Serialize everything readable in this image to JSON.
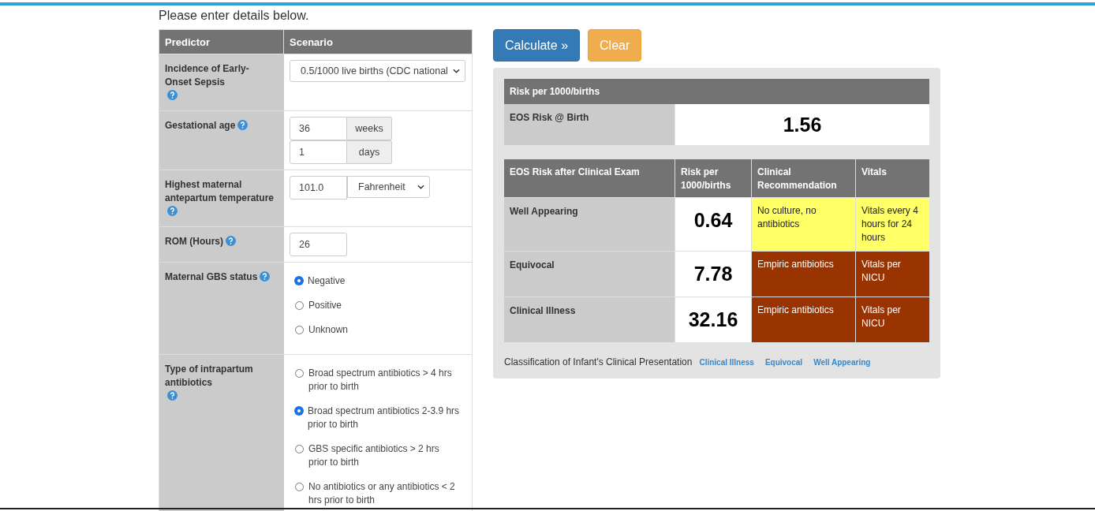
{
  "intro": "Please enter details below.",
  "predictors": {
    "columns": [
      "Predictor",
      "Scenario"
    ],
    "rows": [
      {
        "label": "Incidence of Early-Onset Sepsis",
        "kind": "select",
        "value": "0.5/1000 live births (CDC national"
      },
      {
        "label": "Gestational age",
        "kind": "units",
        "fields": [
          {
            "value": "36",
            "unit": "weeks"
          },
          {
            "value": "1",
            "unit": "days"
          }
        ]
      },
      {
        "label": "Highest maternal antepartum temperature",
        "kind": "input-select",
        "value": "101.0",
        "unit": "Fahrenheit"
      },
      {
        "label": "ROM (Hours)",
        "kind": "input",
        "value": "26"
      },
      {
        "label": "Maternal GBS status",
        "kind": "radio",
        "options": [
          {
            "label": "Negative",
            "selected": true
          },
          {
            "label": "Positive",
            "selected": false
          },
          {
            "label": "Unknown",
            "selected": false
          }
        ]
      },
      {
        "label": "Type of intrapartum antibiotics",
        "kind": "radio",
        "options": [
          {
            "label": "Broad spectrum antibiotics > 4 hrs prior to birth",
            "selected": false
          },
          {
            "label": "Broad spectrum antibiotics 2-3.9 hrs prior to birth",
            "selected": true
          },
          {
            "label": "GBS specific antibiotics > 2 hrs prior to birth",
            "selected": false
          },
          {
            "label": "No antibiotics or any antibiotics < 2 hrs prior to birth",
            "selected": false
          }
        ]
      }
    ]
  },
  "buttons": [
    {
      "label": "Calculate »",
      "kind": "primary"
    },
    {
      "label": "Clear",
      "kind": "warning"
    }
  ],
  "birth_risk": {
    "header": "Risk per 1000/births",
    "label": "EOS Risk @ Birth",
    "value": "1.56"
  },
  "exam_risk": {
    "columns": [
      "EOS Risk after Clinical Exam",
      "Risk per 1000/births",
      "Clinical Recommendation",
      "Vitals"
    ],
    "rows": [
      {
        "label": "Well Appearing",
        "risk": "0.64",
        "recommendation": "No culture, no antibiotics",
        "vitals": "Vitals every 4 hours for 24 hours",
        "color": "#ffff66"
      },
      {
        "label": "Equivocal",
        "risk": "7.78",
        "recommendation": "Empiric antibiotics",
        "vitals": "Vitals per NICU",
        "color": "#993300"
      },
      {
        "label": "Clinical Illness",
        "risk": "32.16",
        "recommendation": "Empiric antibiotics",
        "vitals": "Vitals per NICU",
        "color": "#993300"
      }
    ]
  },
  "classification": {
    "label": "Classification of Infant's Clinical Presentation",
    "links": [
      "Clinical Illness",
      "Equivocal",
      "Well Appearing"
    ]
  }
}
